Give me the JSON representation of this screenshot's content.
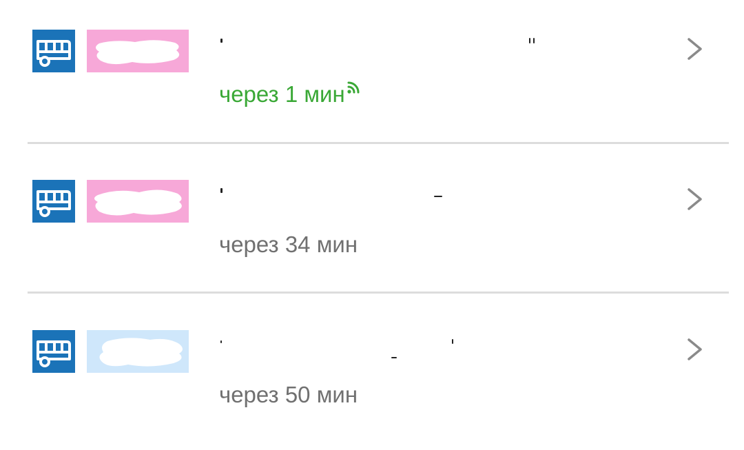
{
  "rows": [
    {
      "icon": "bus-icon",
      "route_badge_color": "#f7a8d8",
      "eta": "через 1 мин",
      "eta_live": true,
      "live_icon": "realtime-signal-icon"
    },
    {
      "icon": "bus-icon",
      "route_badge_color": "#f7a8d8",
      "eta": "через 34 мин",
      "eta_live": false
    },
    {
      "icon": "bus-icon",
      "route_badge_color": "#cfe7fb",
      "eta": "через 50 мин",
      "eta_live": false
    }
  ],
  "colors": {
    "bus_icon_bg": "#1b73b8",
    "eta_live": "#3aa836",
    "eta_scheduled": "#707070",
    "chevron": "#8a8a8a",
    "divider": "#dcdcdc"
  }
}
